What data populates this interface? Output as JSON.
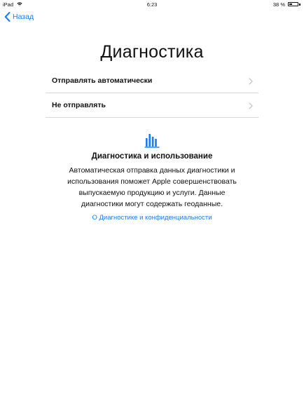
{
  "status_bar": {
    "device": "iPad",
    "time": "6:23",
    "battery": "38 %",
    "battery_level": 0.38,
    "wifi_icon": "wifi-icon",
    "battery_icon": "battery-icon"
  },
  "nav": {
    "back_label": "Назад",
    "back_icon": "chevron-left-icon"
  },
  "page": {
    "title": "Диагностика"
  },
  "options": [
    {
      "label": "Отправлять автоматически",
      "icon": "chevron-right-icon"
    },
    {
      "label": "Не отправлять",
      "icon": "chevron-right-icon"
    }
  ],
  "info": {
    "icon": "bar-chart-icon",
    "heading": "Диагностика и использование",
    "body": "Автоматическая отправка данных диагностики и использования поможет Apple совершенствовать выпускаемую продукцию и услуги. Данные диагностики могут содержать геоданные.",
    "link": "О Диагностике и конфиденциальности"
  },
  "colors": {
    "accent": "#1a7cf5",
    "separator": "#d8d8dc",
    "chevron": "#c7c7cc",
    "background": "#ffffff"
  }
}
